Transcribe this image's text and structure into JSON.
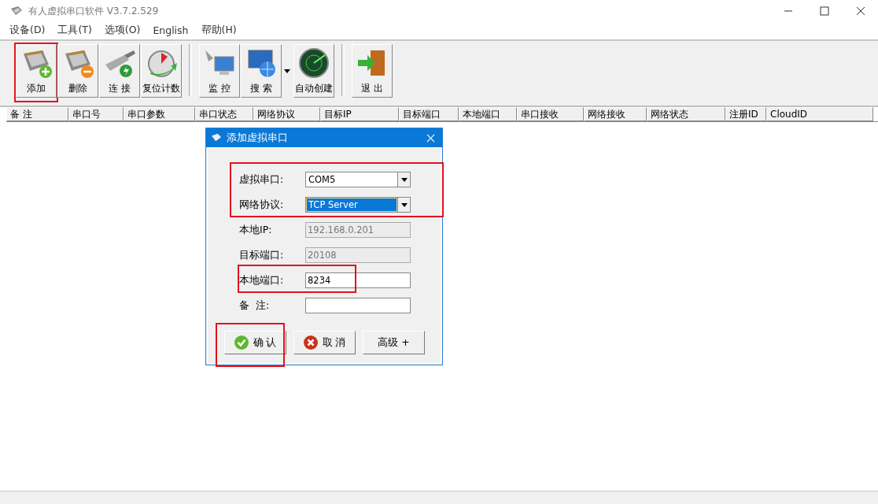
{
  "window": {
    "title": "有人虚拟串口软件 V3.7.2.529"
  },
  "menu": [
    "设备(D)",
    "工具(T)",
    "选项(O)",
    "English",
    "帮助(H)"
  ],
  "toolbar": [
    [
      {
        "label": "添加",
        "highlighted": true
      },
      {
        "label": "删除",
        "highlighted": false
      },
      {
        "label": "连 接",
        "highlighted": false
      },
      {
        "label": "复位计数",
        "highlighted": false
      }
    ],
    [
      {
        "label": "监 控",
        "highlighted": false
      },
      {
        "label": "搜 索",
        "highlighted": false,
        "dropdown": true
      },
      {
        "label": "自动创建",
        "highlighted": false
      }
    ],
    [
      {
        "label": "退 出",
        "highlighted": false
      }
    ]
  ],
  "table": {
    "columns": [
      "备 注",
      "串口号",
      "串口参数",
      "串口状态",
      "网络协议",
      "目标IP",
      "目标端口",
      "本地端口",
      "串口接收",
      "网络接收",
      "网络状态",
      "注册ID",
      "CloudID"
    ]
  },
  "dialog": {
    "title": "添加虚拟串口",
    "sections": [
      {
        "highlighted": true,
        "fields": [
          {
            "label": "虚拟串口:",
            "kind": "dropdown",
            "value": "COM5",
            "selected": false
          },
          {
            "label": "网络协议:",
            "kind": "dropdown",
            "value": "TCP Server",
            "selected": true
          }
        ]
      },
      {
        "highlighted": false,
        "fields": [
          {
            "label": "本地IP:",
            "kind": "text",
            "value": "192.168.0.201",
            "disabled": true
          },
          {
            "label": "目标端口:",
            "kind": "text",
            "value": "20108",
            "disabled": true
          }
        ]
      },
      {
        "highlighted": true,
        "fields": [
          {
            "label": "本地端口:",
            "kind": "text",
            "value": "8234",
            "disabled": false
          }
        ]
      },
      {
        "highlighted": false,
        "fields": [
          {
            "label": "备  注:",
            "kind": "text",
            "disabled": false
          }
        ]
      }
    ],
    "buttons": [
      {
        "label": "确 认",
        "kind": "ok",
        "highlighted": true
      },
      {
        "label": "取 消",
        "kind": "cancel",
        "highlighted": false
      },
      {
        "label": "高级 +",
        "kind": "plain",
        "highlighted": false
      }
    ]
  }
}
